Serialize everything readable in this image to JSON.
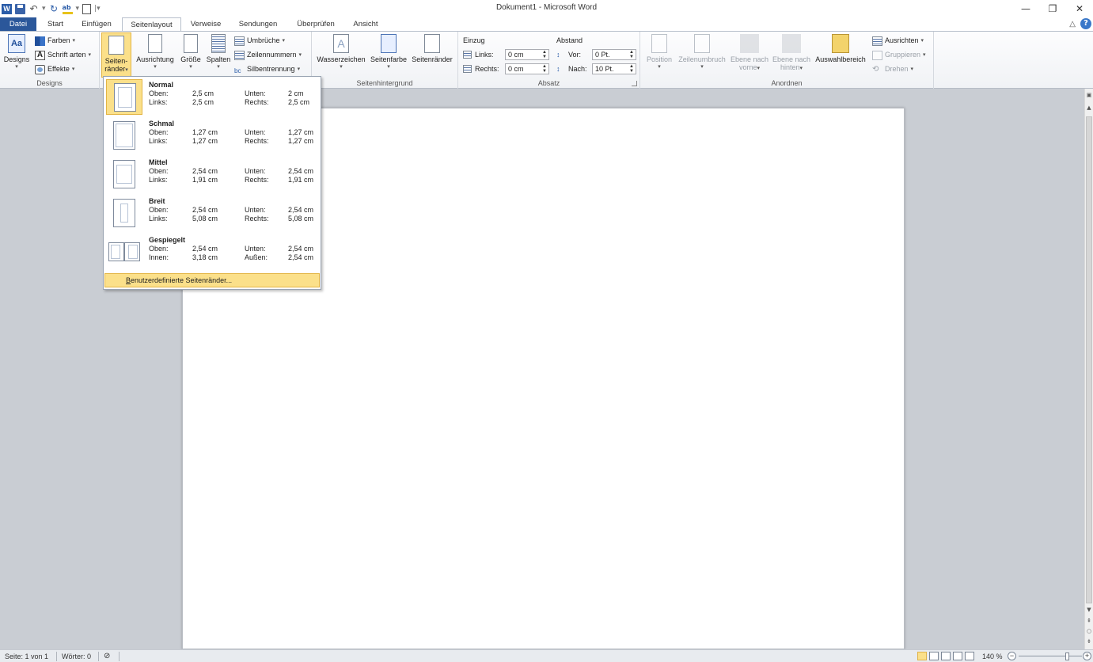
{
  "titlebar": {
    "title": "Dokument1 - Microsoft Word",
    "word_logo": "W",
    "minimize": "—",
    "restore": "❐",
    "close": "✕"
  },
  "tabs": {
    "file": "Datei",
    "items": [
      "Start",
      "Einfügen",
      "Seitenlayout",
      "Verweise",
      "Sendungen",
      "Überprüfen",
      "Ansicht"
    ],
    "active": "Seitenlayout"
  },
  "ribbon": {
    "designs": {
      "label": "Designs",
      "designs_btn": "Designs",
      "farben": "Farben",
      "schriftarten": "Schrift arten",
      "effekte": "Effekte"
    },
    "seite_einrichten": {
      "seitenraender_l1": "Seiten-",
      "seitenraender_l2": "ränder",
      "ausrichtung": "Ausrichtung",
      "groesse": "Größe",
      "spalten": "Spalten",
      "umbrueche": "Umbrüche",
      "zeilennummern": "Zeilennummern",
      "silbentrennung": "Silbentrennung"
    },
    "seitenhintergrund": {
      "label": "Seitenhintergrund",
      "wasserzeichen": "Wasserzeichen",
      "seitenfarbe": "Seitenfarbe",
      "seitenraender": "Seitenränder"
    },
    "absatz": {
      "label": "Absatz",
      "einzug": "Einzug",
      "abstand": "Abstand",
      "links_label": "Links:",
      "links_value": "0 cm",
      "rechts_label": "Rechts:",
      "rechts_value": "0 cm",
      "vor_label": "Vor:",
      "vor_value": "0 Pt.",
      "nach_label": "Nach:",
      "nach_value": "10 Pt."
    },
    "anordnen": {
      "label": "Anordnen",
      "position": "Position",
      "zeilenumbruch": "Zeilenumbruch",
      "ebene_vorne_l1": "Ebene nach",
      "ebene_vorne_l2": "vorne",
      "ebene_hinten_l1": "Ebene nach",
      "ebene_hinten_l2": "hinten",
      "auswahlbereich": "Auswahlbereich",
      "ausrichten": "Ausrichten",
      "gruppieren": "Gruppieren",
      "drehen": "Drehen"
    }
  },
  "margins_menu": {
    "items": [
      {
        "title": "Normal",
        "l1": "Oben:",
        "v1": "2,5  cm",
        "r1": "Unten:",
        "w1": "2  cm",
        "l2": "Links:",
        "v2": "2,5  cm",
        "r2": "Rechts:",
        "w2": "2,5  cm"
      },
      {
        "title": "Schmal",
        "l1": "Oben:",
        "v1": "1,27  cm",
        "r1": "Unten:",
        "w1": "1,27  cm",
        "l2": "Links:",
        "v2": "1,27  cm",
        "r2": "Rechts:",
        "w2": "1,27  cm"
      },
      {
        "title": "Mittel",
        "l1": "Oben:",
        "v1": "2,54  cm",
        "r1": "Unten:",
        "w1": "2,54  cm",
        "l2": "Links:",
        "v2": "1,91  cm",
        "r2": "Rechts:",
        "w2": "1,91  cm"
      },
      {
        "title": "Breit",
        "l1": "Oben:",
        "v1": "2,54  cm",
        "r1": "Unten:",
        "w1": "2,54  cm",
        "l2": "Links:",
        "v2": "5,08  cm",
        "r2": "Rechts:",
        "w2": "5,08  cm"
      },
      {
        "title": "Gespiegelt",
        "l1": "Oben:",
        "v1": "2,54  cm",
        "r1": "Unten:",
        "w1": "2,54  cm",
        "l2": "Innen:",
        "v2": "3,18  cm",
        "r2": "Außen:",
        "w2": "2,54  cm"
      }
    ],
    "custom_underlined": "B",
    "custom_rest": "enutzerdefinierte Seitenränder..."
  },
  "statusbar": {
    "page": "Seite: 1 von 1",
    "words": "Wörter: 0",
    "zoom": "140 %",
    "zoom_fraction": 0.78,
    "minus": "−",
    "plus": "+"
  },
  "colors": {
    "file_tab": "#2b579a",
    "highlight": "#fbe08a",
    "highlight_border": "#e3b545"
  }
}
